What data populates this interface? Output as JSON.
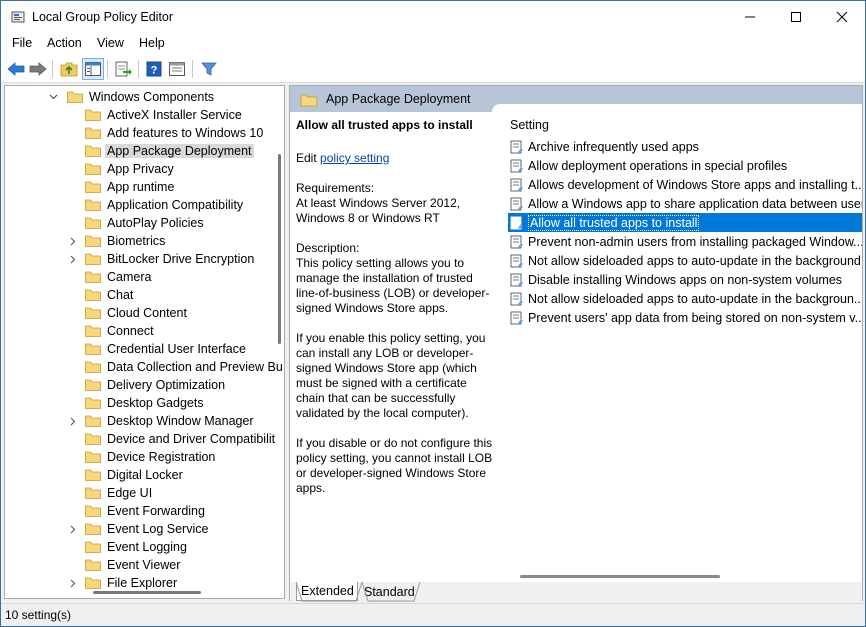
{
  "window": {
    "title": "Local Group Policy Editor"
  },
  "menu": [
    "File",
    "Action",
    "View",
    "Help"
  ],
  "toolbar": {
    "buttons": [
      "back-arrow-icon",
      "forward-arrow-icon",
      "up-folder-icon",
      "show-hide-tree-icon",
      "export-list-icon",
      "help-icon",
      "properties-icon",
      "filter-icon"
    ]
  },
  "tree": {
    "parent": "Windows Components",
    "items": [
      {
        "label": "ActiveX Installer Service",
        "expandable": false
      },
      {
        "label": "Add features to Windows 10",
        "expandable": false
      },
      {
        "label": "App Package Deployment",
        "expandable": false,
        "selected": true
      },
      {
        "label": "App Privacy",
        "expandable": false
      },
      {
        "label": "App runtime",
        "expandable": false
      },
      {
        "label": "Application Compatibility",
        "expandable": false
      },
      {
        "label": "AutoPlay Policies",
        "expandable": false
      },
      {
        "label": "Biometrics",
        "expandable": true
      },
      {
        "label": "BitLocker Drive Encryption",
        "expandable": true
      },
      {
        "label": "Camera",
        "expandable": false
      },
      {
        "label": "Chat",
        "expandable": false
      },
      {
        "label": "Cloud Content",
        "expandable": false
      },
      {
        "label": "Connect",
        "expandable": false
      },
      {
        "label": "Credential User Interface",
        "expandable": false
      },
      {
        "label": "Data Collection and Preview Bu",
        "expandable": false
      },
      {
        "label": "Delivery Optimization",
        "expandable": false
      },
      {
        "label": "Desktop Gadgets",
        "expandable": false
      },
      {
        "label": "Desktop Window Manager",
        "expandable": true
      },
      {
        "label": "Device and Driver Compatibilit",
        "expandable": false
      },
      {
        "label": "Device Registration",
        "expandable": false
      },
      {
        "label": "Digital Locker",
        "expandable": false
      },
      {
        "label": "Edge UI",
        "expandable": false
      },
      {
        "label": "Event Forwarding",
        "expandable": false
      },
      {
        "label": "Event Log Service",
        "expandable": true
      },
      {
        "label": "Event Logging",
        "expandable": false
      },
      {
        "label": "Event Viewer",
        "expandable": false
      },
      {
        "label": "File Explorer",
        "expandable": true
      }
    ]
  },
  "right": {
    "header_title": "App Package Deployment",
    "description": {
      "title": "Allow all trusted apps to install",
      "edit_prefix": "Edit ",
      "edit_link": "policy setting",
      "requirements": "Requirements:\nAt least Windows Server 2012, Windows 8 or Windows RT",
      "desc1": "Description:\nThis policy setting allows you to manage the installation of trusted line-of-business (LOB) or developer-signed Windows Store apps.",
      "desc2": "If you enable this policy setting, you can install any LOB or developer-signed Windows Store app (which must be signed with a certificate chain that can be successfully validated by the local computer).",
      "desc3": "If you disable or do not configure this policy setting, you cannot install LOB or developer-signed Windows Store apps."
    },
    "list_header": "Setting",
    "settings": [
      {
        "label": "Archive infrequently used apps"
      },
      {
        "label": "Allow deployment operations in special profiles"
      },
      {
        "label": "Allows development of Windows Store apps and installing t..."
      },
      {
        "label": "Allow a Windows app to share application data between users"
      },
      {
        "label": "Allow all trusted apps to install",
        "selected": true
      },
      {
        "label": "Prevent non-admin users from installing packaged Window..."
      },
      {
        "label": "Not allow sideloaded apps to auto-update in the background"
      },
      {
        "label": "Disable installing Windows apps on non-system volumes"
      },
      {
        "label": "Not allow sideloaded apps to auto-update in the backgroun..."
      },
      {
        "label": "Prevent users' app data from being stored on non-system v..."
      }
    ],
    "tabs": [
      "Extended",
      "Standard"
    ]
  },
  "status": {
    "text": "10 setting(s)"
  }
}
